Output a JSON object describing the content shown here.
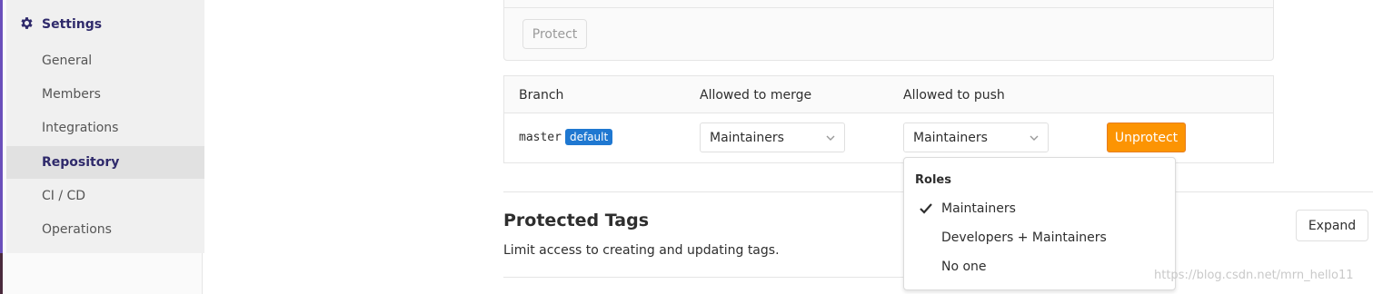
{
  "sidebar": {
    "section_title": "Settings",
    "items": [
      {
        "label": "General"
      },
      {
        "label": "Members"
      },
      {
        "label": "Integrations"
      },
      {
        "label": "Repository"
      },
      {
        "label": "CI / CD"
      },
      {
        "label": "Operations"
      }
    ],
    "active_item": "Repository",
    "accent_color": "#2f2a6b"
  },
  "protect_form": {
    "protect_button_label": "Protect"
  },
  "branches_table": {
    "headers": {
      "branch": "Branch",
      "merge": "Allowed to merge",
      "push": "Allowed to push"
    },
    "rows": [
      {
        "branch": "master",
        "badge": "default",
        "allowed_to_merge": "Maintainers",
        "allowed_to_push": "Maintainers",
        "action_label": "Unprotect"
      }
    ]
  },
  "push_dropdown": {
    "header": "Roles",
    "options": [
      {
        "label": "Maintainers",
        "checked": true
      },
      {
        "label": "Developers + Maintainers",
        "checked": false
      },
      {
        "label": "No one",
        "checked": false
      }
    ]
  },
  "protected_tags": {
    "title": "Protected Tags",
    "description": "Limit access to creating and updating tags.",
    "expand_label": "Expand"
  },
  "watermark": "https://blog.csdn.net/mrn_hello11",
  "colors": {
    "badge": "#1f78d1",
    "unprotect": "#fc9403"
  }
}
